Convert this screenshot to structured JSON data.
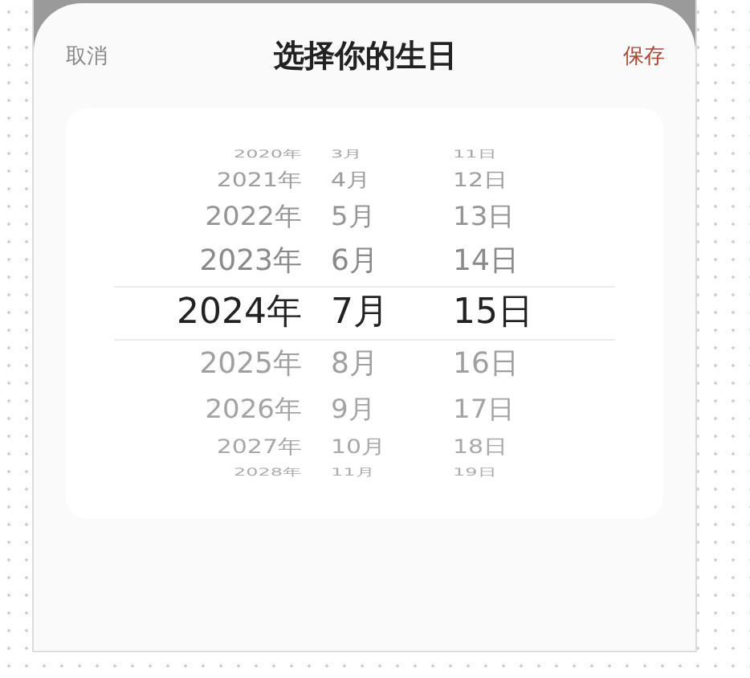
{
  "sheet": {
    "cancel": "取消",
    "title": "选择你的生日",
    "save": "保存"
  },
  "picker": {
    "rows": [
      {
        "year": "2020年",
        "month": "3月",
        "day": "11日",
        "selected": false
      },
      {
        "year": "2021年",
        "month": "4月",
        "day": "12日",
        "selected": false
      },
      {
        "year": "2022年",
        "month": "5月",
        "day": "13日",
        "selected": false
      },
      {
        "year": "2023年",
        "month": "6月",
        "day": "14日",
        "selected": false
      },
      {
        "year": "2024年",
        "month": "7月",
        "day": "15日",
        "selected": true
      },
      {
        "year": "2025年",
        "month": "8月",
        "day": "16日",
        "selected": false
      },
      {
        "year": "2026年",
        "month": "9月",
        "day": "17日",
        "selected": false
      },
      {
        "year": "2027年",
        "month": "10月",
        "day": "18日",
        "selected": false
      },
      {
        "year": "2028年",
        "month": "11月",
        "day": "19日",
        "selected": false
      }
    ]
  }
}
